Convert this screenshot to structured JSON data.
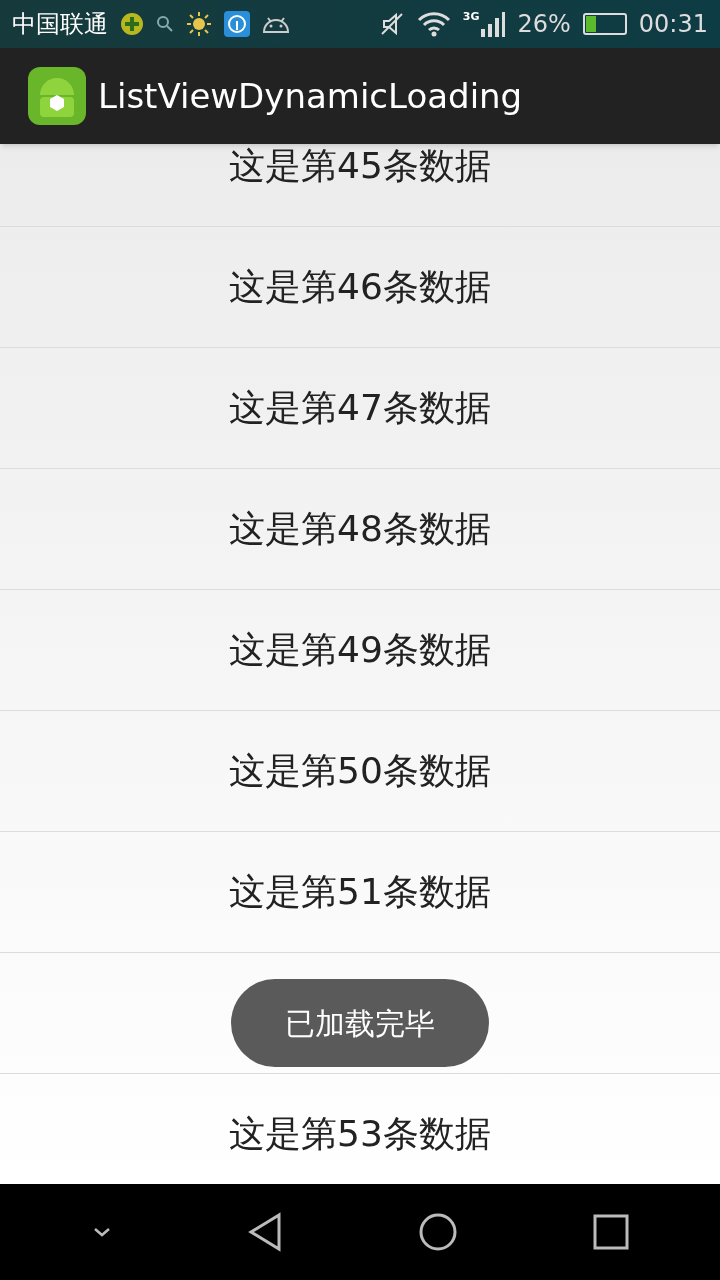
{
  "status_bar": {
    "carrier": "中国联通",
    "network": "3G",
    "battery_percent": "26%",
    "time": "00:31"
  },
  "action_bar": {
    "title": "ListViewDynamicLoading"
  },
  "list": {
    "rows": [
      {
        "label": "这是第45条数据"
      },
      {
        "label": "这是第46条数据"
      },
      {
        "label": "这是第47条数据"
      },
      {
        "label": "这是第48条数据"
      },
      {
        "label": "这是第49条数据"
      },
      {
        "label": "这是第50条数据"
      },
      {
        "label": "这是第51条数据"
      },
      {
        "covered": true
      },
      {
        "label": "这是第53条数据"
      }
    ]
  },
  "toast": {
    "text": "已加载完毕"
  }
}
